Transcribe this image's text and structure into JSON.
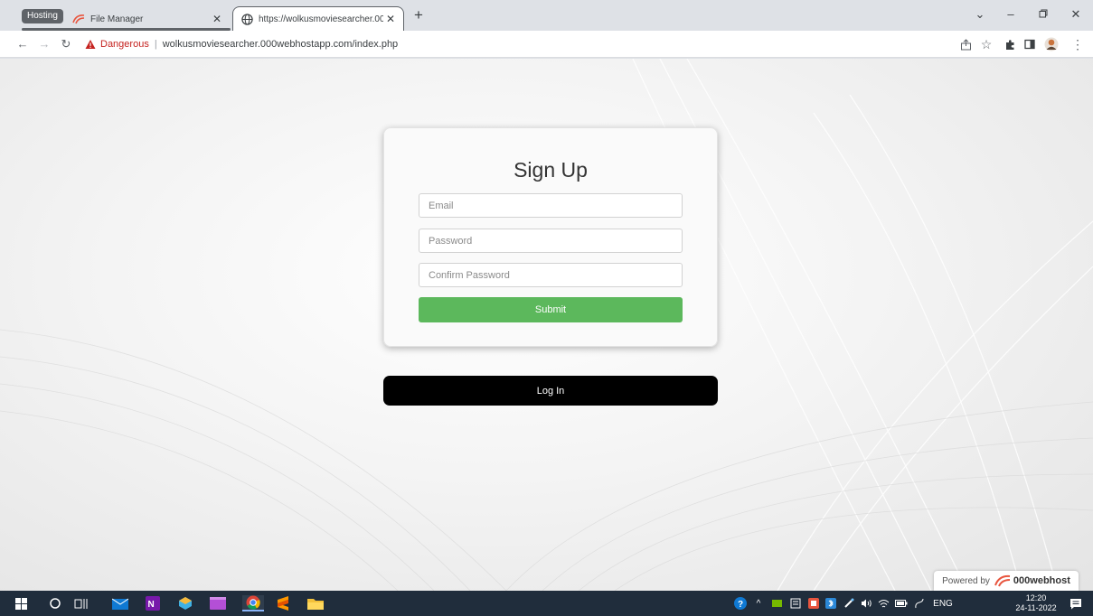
{
  "browser": {
    "tab_group_label": "Hosting",
    "tabs": [
      {
        "title": "File Manager",
        "active": false
      },
      {
        "title": "https://wolkusmoviesearcher.000",
        "active": true
      }
    ],
    "address": {
      "security_label": "Dangerous",
      "separator": "|",
      "url": "wolkusmoviesearcher.000webhostapp.com/index.php"
    }
  },
  "page": {
    "signup": {
      "title": "Sign Up",
      "email_placeholder": "Email",
      "password_placeholder": "Password",
      "confirm_placeholder": "Confirm Password",
      "submit_label": "Submit"
    },
    "login_label": "Log In",
    "powered_by": {
      "prefix": "Powered by",
      "brand": "000webhost"
    }
  },
  "taskbar": {
    "language": "ENG",
    "time": "12:20",
    "date": "24-11-2022"
  },
  "colors": {
    "submit": "#5cb85c",
    "login": "#000000",
    "danger": "#c5221f",
    "taskbar": "#202d3c"
  }
}
